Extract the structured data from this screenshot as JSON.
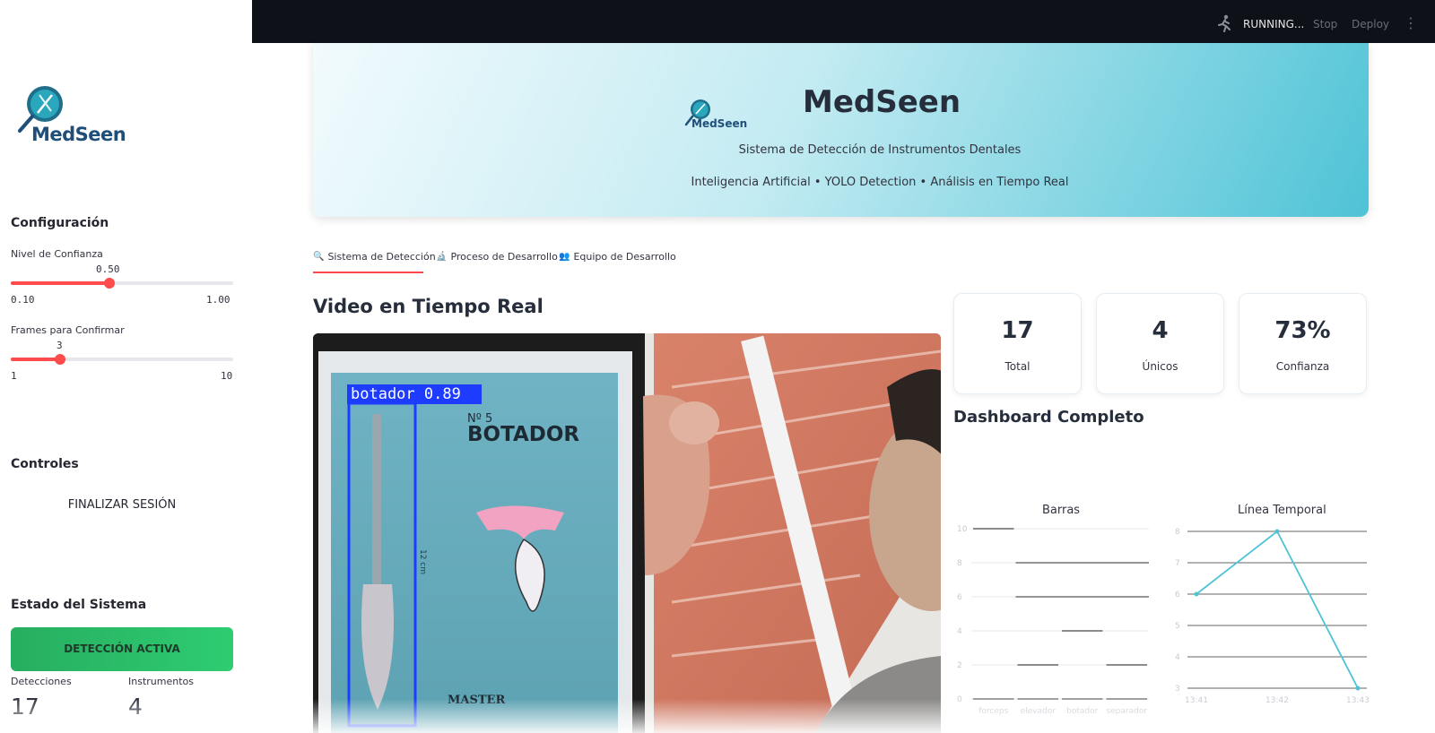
{
  "sidebar": {
    "logo_text": "MedSeen",
    "config_title": "Configuración",
    "confidence": {
      "label": "Nivel de Confianza",
      "value": "0.50",
      "fraction": 0.444,
      "min": "0.10",
      "max": "1.00"
    },
    "frames": {
      "label": "Frames para Confirmar",
      "value": "3",
      "fraction": 0.222,
      "min": "1",
      "max": "10"
    },
    "controls_title": "Controles",
    "end_session_label": "FINALIZAR SESIÓN",
    "status_title": "Estado del Sistema",
    "status_label": "DETECCIÓN ACTIVA",
    "detections": {
      "label": "Detecciones",
      "value": "17"
    },
    "instruments": {
      "label": "Instrumentos",
      "value": "4"
    }
  },
  "topbar": {
    "running": "RUNNING...",
    "stop": "Stop",
    "deploy": "Deploy"
  },
  "banner": {
    "logo_text": "MedSeen",
    "title": "MedSeen",
    "subtitle": "Sistema de Detección de Instrumentos Dentales",
    "tagline": "Inteligencia Artificial • YOLO Detection • Análisis en Tiempo Real"
  },
  "tabs": [
    {
      "icon": "magnifier-icon",
      "label": "Sistema de Detección"
    },
    {
      "icon": "microscope-icon",
      "label": "Proceso de Desarrollo"
    },
    {
      "icon": "people-icon",
      "label": "Equipo de Desarrollo"
    }
  ],
  "video": {
    "title": "Video en Tiempo Real",
    "detection_label": "botador 0.89",
    "card_number": "Nº 5",
    "card_text": "BOTADOR",
    "measure": "12 cm",
    "brand": "MASTER"
  },
  "metrics": [
    {
      "value": "17",
      "label": "Total"
    },
    {
      "value": "4",
      "label": "Únicos"
    },
    {
      "value": "73%",
      "label": "Confianza"
    }
  ],
  "dashboard": {
    "title": "Dashboard Completo",
    "bar_chart_title": "Barras",
    "line_chart_title": "Línea Temporal"
  },
  "chart_data": [
    {
      "type": "bar",
      "title": "Barras",
      "categories": [
        "forceps",
        "elevador",
        "botador",
        "separador"
      ],
      "values": [
        10,
        2,
        4,
        2
      ],
      "ylim": [
        0,
        10
      ],
      "yticks": [
        "0",
        "2",
        "4",
        "6",
        "8",
        "10"
      ]
    },
    {
      "type": "line",
      "title": "Línea Temporal",
      "x": [
        "13:41",
        "13:42",
        "13:43"
      ],
      "values": [
        6,
        8,
        3
      ],
      "ylim": [
        3,
        8
      ],
      "yticks": [
        "3",
        "4",
        "5",
        "6",
        "7",
        "8"
      ],
      "color": "#4ec3d6"
    }
  ]
}
